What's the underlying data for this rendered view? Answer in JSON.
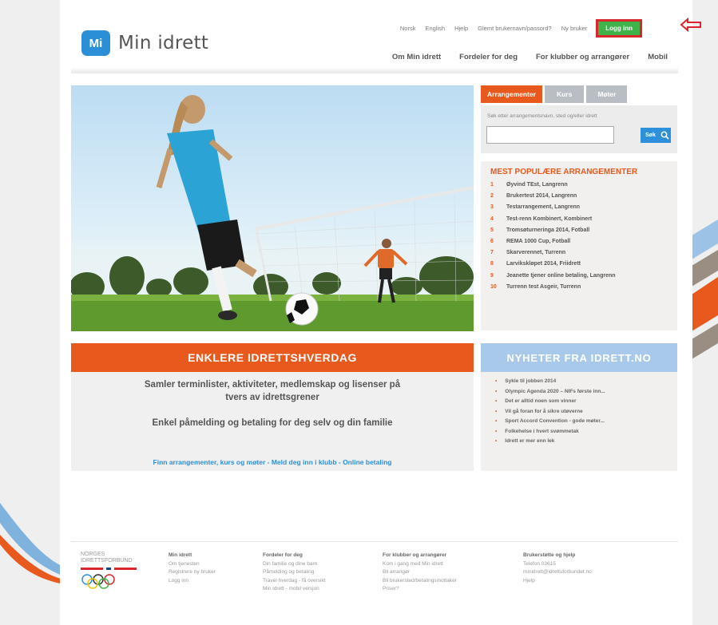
{
  "header": {
    "top_links": [
      "Norsk",
      "English",
      "Hjelp",
      "Glemt brukernavn/passord?",
      "Ny bruker"
    ],
    "login_label": "Logg inn",
    "logo_badge": "Mi",
    "logo_text": "Min idrett",
    "nav": [
      "Om Min idrett",
      "Fordeler for deg",
      "For klubber og arrangører",
      "Mobil"
    ]
  },
  "search": {
    "tabs": [
      "Arrangementer",
      "Kurs",
      "Møter"
    ],
    "active_tab": "Arrangementer",
    "hint": "Søk etter arrangementsnavn, sted og/eller idrett",
    "input_value": "",
    "button_label": "Søk"
  },
  "popular": {
    "title": "MEST POPULÆRE ARRANGEMENTER",
    "items": [
      {
        "num": "1",
        "label": "Øyvind TEst, Langrenn"
      },
      {
        "num": "2",
        "label": "Brukertest 2014, Langrenn"
      },
      {
        "num": "3",
        "label": "Testarrangement, Langrenn"
      },
      {
        "num": "4",
        "label": "Test-renn Kombinert, Kombinert"
      },
      {
        "num": "5",
        "label": "Tromsøturneringa 2014, Fotball"
      },
      {
        "num": "6",
        "label": "REMA 1000 Cup, Fotball"
      },
      {
        "num": "7",
        "label": "Skarverennet, Turrenn"
      },
      {
        "num": "8",
        "label": "Larvikskløpet 2014, Friidrett"
      },
      {
        "num": "9",
        "label": "Jeanette tjener online betaling, Langrenn"
      },
      {
        "num": "10",
        "label": "Turrenn test Asgeir, Turrenn"
      }
    ]
  },
  "promo": {
    "banner": "ENKLERE IDRETTSHVERDAG",
    "line1": "Samler terminlister, aktiviteter, medlemskap og lisenser på tvers av idrettsgrener",
    "line2": "Enkel påmelding og betaling for deg selv og din familie",
    "links": "Finn arrangementer, kurs og møter - Meld deg inn i klubb - Online betaling"
  },
  "news": {
    "title": "NYHETER FRA IDRETT.NO",
    "items": [
      "Sykle til jobben 2014",
      "Olympic Agenda 2020 – NIFs første inn...",
      "Det er alltid noen som vinner",
      "Vil gå foran for å sikre utøverne",
      "Sport Accord Convention - gode møter...",
      "Folkehelse i hvert svømmetak",
      "Idrett er mer enn lek"
    ]
  },
  "footer": {
    "org_line1": "NORGES",
    "org_line2": "IDRETTSFORBUND",
    "columns": [
      {
        "heading": "Min idrett",
        "items": [
          "Om tjenesten",
          "Registrere ny bruker",
          "Logg inn"
        ]
      },
      {
        "heading": "Fordeler for deg",
        "items": [
          "Din familie og dine barn",
          "Påmelding og betaling",
          "Travel hverdag - få oversikt",
          "Min idrett - mobil versjon"
        ]
      },
      {
        "heading": "For klubber og arrangører",
        "items": [
          "Kom i gang med Min idrett",
          "Bli arrangør",
          "Bli brukersted/betalingsmottaker",
          "Priser?"
        ]
      },
      {
        "heading": "Brukerstøtte og hjelp",
        "items": [
          "Telefon 03615",
          "minidrett@idrettsforbundet.no",
          "Hjelp"
        ]
      }
    ]
  },
  "colors": {
    "accent": "#e8591d",
    "login_green": "#3fb24a",
    "highlight_red": "#d9262c",
    "link_blue": "#2e8fda",
    "news_blue": "#a9c9ea"
  }
}
